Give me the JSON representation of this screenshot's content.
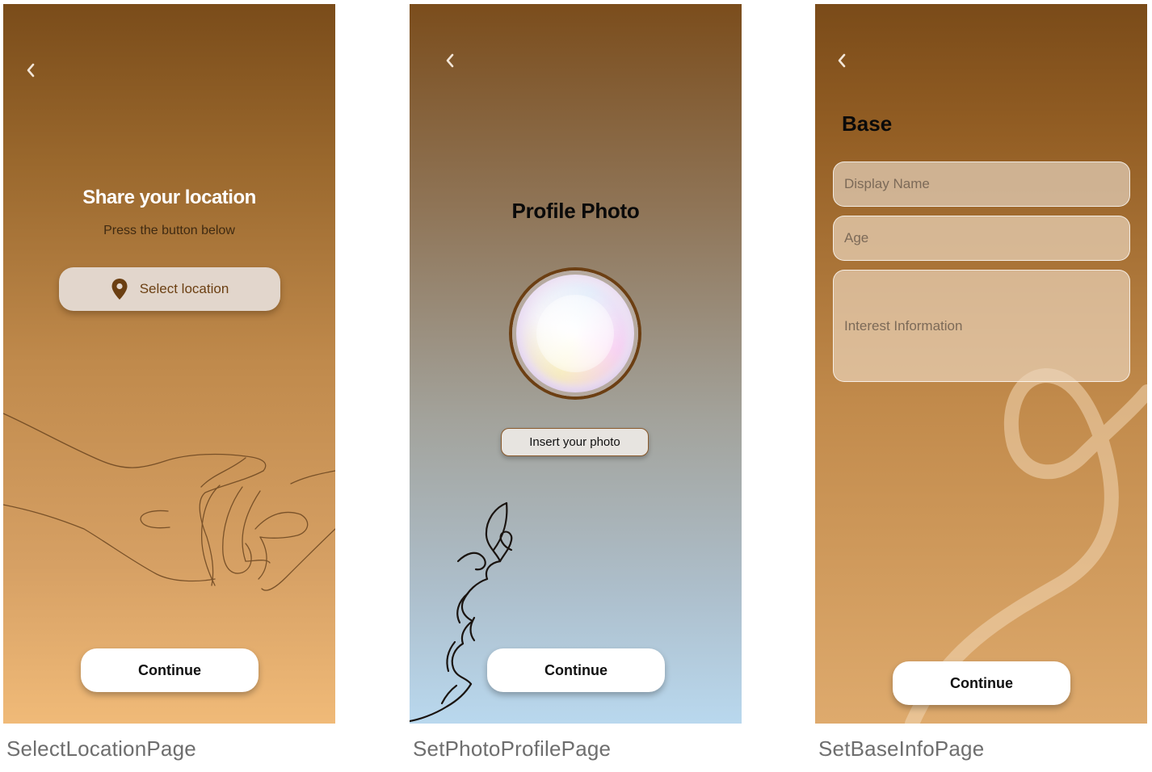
{
  "screens": {
    "location": {
      "title": "Share your location",
      "subtitle": "Press the button below",
      "select_button": {
        "label": "Select location",
        "icon": "map-pin-icon",
        "icon_color": "#6b3f12"
      },
      "continue_label": "Continue",
      "back_icon": "chevron-left-icon",
      "illustration": "holding-hands-line-art"
    },
    "photo": {
      "title": "Profile Photo",
      "insert_button_label": "Insert your photo",
      "continue_label": "Continue",
      "back_icon": "chevron-left-icon",
      "illustration": "face-profile-line-art"
    },
    "base": {
      "title": "Base",
      "fields": {
        "display_name": {
          "placeholder": "Display Name",
          "value": ""
        },
        "age": {
          "placeholder": "Age",
          "value": ""
        },
        "interest": {
          "placeholder": "Interest Information",
          "value": ""
        }
      },
      "continue_label": "Continue",
      "back_icon": "chevron-left-icon",
      "illustration": "loop-ribbon"
    }
  },
  "captions": {
    "location": "SelectLocationPage",
    "photo": "SetPhotoProfilePage",
    "base": "SetBaseInfoPage"
  },
  "colors": {
    "brown_top": "#7a4c1a",
    "peach_bottom": "#f0ba78",
    "sky_bottom": "#b9d8ee",
    "button_white": "#ffffff"
  }
}
